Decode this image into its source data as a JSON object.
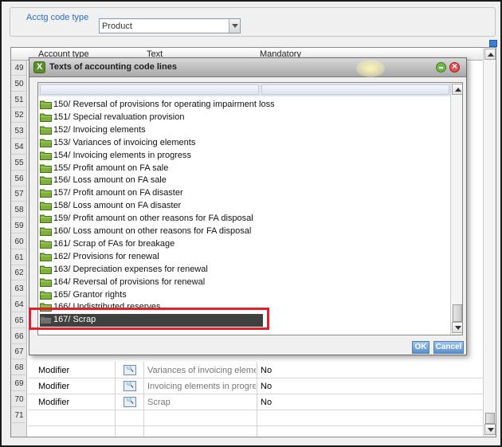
{
  "filter": {
    "label": "Acctg code type",
    "value": "Product"
  },
  "grid": {
    "columns": [
      "Account type",
      "Text",
      "Mandatory"
    ],
    "row_numbers": [
      "49",
      "50",
      "51",
      "52",
      "53",
      "54",
      "55",
      "56",
      "57",
      "58",
      "59",
      "60",
      "61",
      "62",
      "63",
      "64",
      "65",
      "66",
      "67",
      "68",
      "69",
      "70",
      "71"
    ],
    "rows": [
      {
        "num": "68",
        "type": "Modifier",
        "text": "Variances of invoicing elements",
        "mandatory": "No"
      },
      {
        "num": "69",
        "type": "Modifier",
        "text": "Invoicing elements in progress",
        "mandatory": "No"
      },
      {
        "num": "70",
        "type": "Modifier",
        "text": "Scrap",
        "mandatory": "No"
      },
      {
        "num": "71",
        "type": "",
        "text": "",
        "mandatory": ""
      }
    ]
  },
  "popup": {
    "title": "Texts of accounting code lines",
    "items": [
      "150/ Reversal of provisions for operating impairment loss",
      "151/ Special revaluation provision",
      "152/ Invoicing elements",
      "153/ Variances of invoicing elements",
      "154/ Invoicing elements in progress",
      "155/ Profit amount on FA sale",
      "156/ Loss amount on  FA sale",
      "157/ Profit amount on FA disaster",
      "158/ Loss amount on FA disaster",
      "159/ Profit amount on other reasons for FA disposal",
      "160/ Loss amount on other reasons for FA disposal",
      "161/ Scrap of FAs for breakage",
      "162/ Provisions for renewal",
      "163/ Depreciation expenses for renewal",
      "164/ Reversal of provisions for renewal",
      "165/ Grantor rights",
      "166/ Undistributed reserves",
      "167/ Scrap"
    ],
    "selected_index": 17,
    "ok_label": "OK",
    "cancel_label": "Cancel"
  },
  "colors": {
    "label_blue": "#2a6cc8",
    "highlight_red": "#e0202a",
    "selected_row": "#404040",
    "button_blue": "#5b8fc9"
  },
  "icons": [
    "folder-icon",
    "lookup-icon",
    "minimize-icon",
    "close-icon",
    "app-logo-icon"
  ]
}
